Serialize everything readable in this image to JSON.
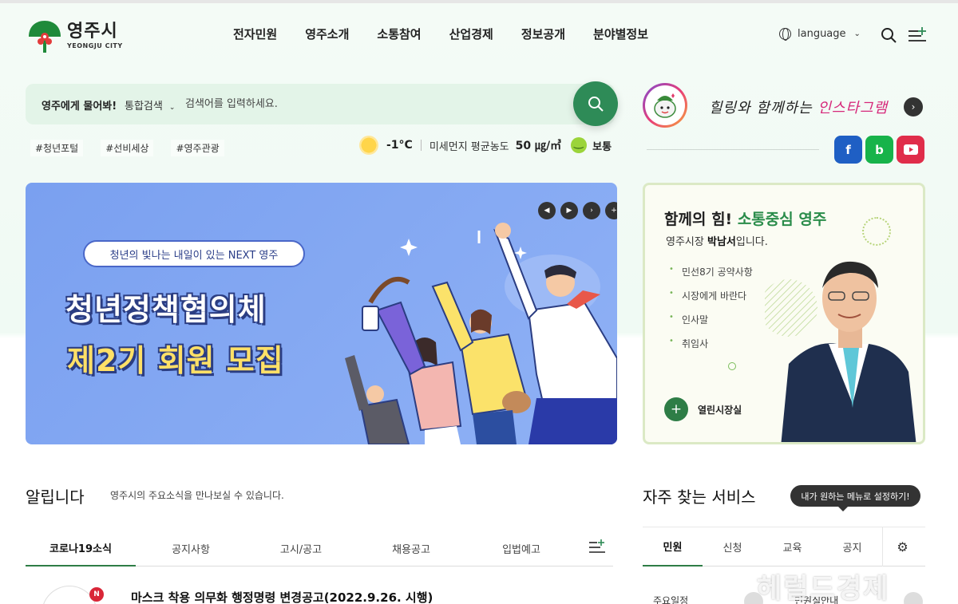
{
  "header": {
    "logo_main": "영주시",
    "logo_sub": "YEONGJU CITY",
    "nav": [
      "전자민원",
      "영주소개",
      "소통참여",
      "산업경제",
      "정보공개",
      "분야별정보"
    ],
    "language": "language"
  },
  "search": {
    "ask": "영주에게 물어봐!",
    "scope": "통합검색",
    "placeholder": "검색어를 입력하세요."
  },
  "tags": [
    "#청년포털",
    "#선비세상",
    "#영주관광"
  ],
  "weather": {
    "temp": "-1°C",
    "dust_label": "미세먼지 평균농도",
    "dust_value": "50 ㎍/㎥",
    "dust_state": "보통"
  },
  "instagram": {
    "text_prefix": "힐링와 함께하는 ",
    "text_highlight": "인스타그램"
  },
  "sns": [
    "f",
    "b"
  ],
  "banner": {
    "pill": "청년의 빛나는 내일이 있는 NEXT 영주",
    "title1": "청년정책협의체",
    "title2": "제2기 회원 모집"
  },
  "mayor": {
    "title_a": "함께",
    "title_b": "의 힘! ",
    "title_c": "소통중심 영주",
    "sub_a": "영주시장 ",
    "sub_name": "박남서",
    "sub_b": "입니다.",
    "links": [
      "민선8기 공약사항",
      "시장에게 바란다",
      "인사말",
      "취임사"
    ],
    "button": "열린시장실"
  },
  "notice": {
    "title": "알립니다",
    "desc": "영주시의 주요소식을 만나보실 수 있습니다.",
    "tabs": [
      "코로나19소식",
      "공지사항",
      "고시/공고",
      "채용공고",
      "입법예고"
    ],
    "badge": "N",
    "headline": "마스크 착용 의무화 행정명령 변경공고(2022.9.26. 시행)"
  },
  "services": {
    "title": "자주 찾는 서비스",
    "tooltip": "내가 원하는 메뉴로 설정하기!",
    "tabs": [
      "민원",
      "신청",
      "교육",
      "공지"
    ],
    "item1": "주요일정",
    "item2": "민원실안내"
  },
  "watermark": "헤럴드경제",
  "colors": {
    "primary_green": "#2e8b57",
    "mayor_green": "#2a8c4a",
    "banner_blue": "#7aa0f0",
    "instagram_pink": "#d6287a",
    "facebook": "#1f5fc4",
    "blog": "#17b34a",
    "youtube": "#e02d4a"
  }
}
